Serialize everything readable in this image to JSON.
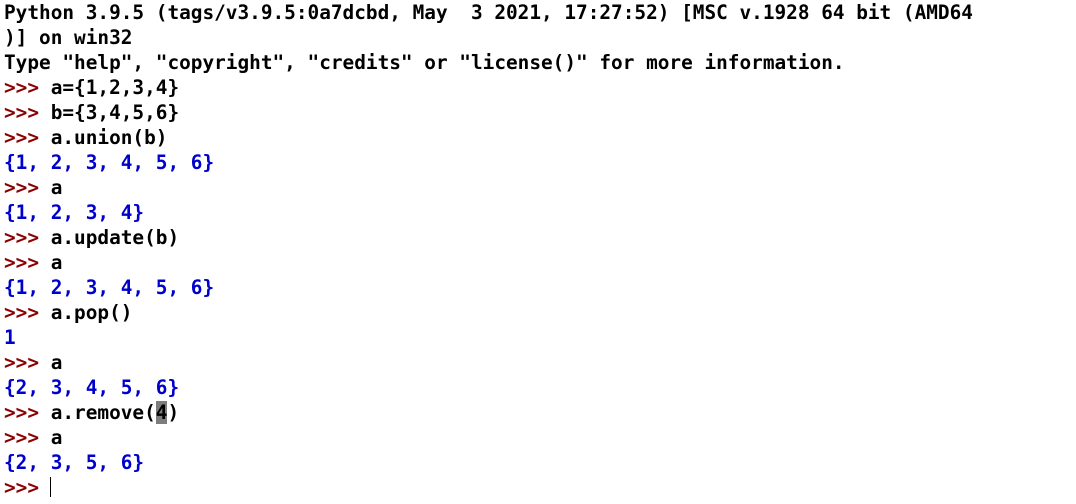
{
  "banner": [
    "Python 3.9.5 (tags/v3.9.5:0a7dcbd, May  3 2021, 17:27:52) [MSC v.1928 64 bit (AMD64",
    ")] on win32",
    "Type \"help\", \"copyright\", \"credits\" or \"license()\" for more information."
  ],
  "prompt": ">>> ",
  "session": [
    {
      "input": "a={1,2,3,4}"
    },
    {
      "input": "b={3,4,5,6}"
    },
    {
      "input": "a.union(b)",
      "output": "{1, 2, 3, 4, 5, 6}"
    },
    {
      "input": "a",
      "output": "{1, 2, 3, 4}"
    },
    {
      "input": "a.update(b)"
    },
    {
      "input": "a",
      "output": "{1, 2, 3, 4, 5, 6}"
    },
    {
      "input": "a.pop()",
      "output": "1"
    },
    {
      "input": "a",
      "output": "{2, 3, 4, 5, 6}"
    },
    {
      "input_before": "a.remove(",
      "input_selected": "4",
      "input_after": ")"
    },
    {
      "input": "a",
      "output": "{2, 3, 5, 6}"
    }
  ],
  "colors": {
    "background": "#ffffff",
    "prompt": "#8b0000",
    "input": "#000000",
    "output": "#0000cd",
    "selection": "#7d7d7d"
  }
}
